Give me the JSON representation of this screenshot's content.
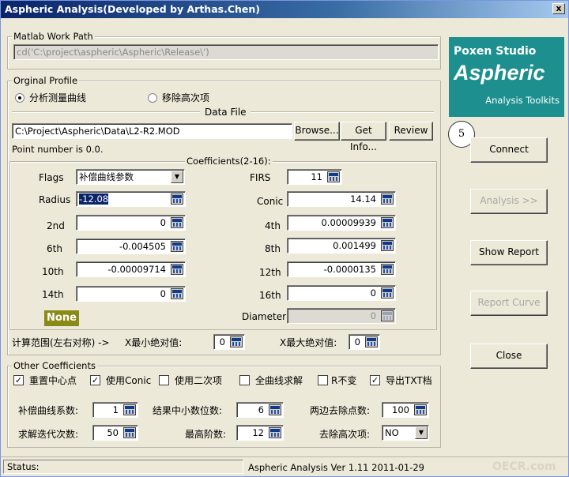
{
  "window": {
    "title": "Aspheric Analysis(Developed by Arthas.Chen)",
    "close_label": "x"
  },
  "matlab": {
    "legend": "Matlab Work Path",
    "path": "cd('C:\\project\\aspheric\\Aspheric\\Release\\')"
  },
  "profile": {
    "legend": "Orginal Profile",
    "radio_measure": "分析测量曲线",
    "radio_remove": "移除高次项",
    "data_file_label": "Data File",
    "data_file_path": "C:\\Project\\Aspheric\\Data\\L2-R2.MOD",
    "browse": "Browse...",
    "get_info": "Get Info...",
    "review": "Review",
    "point_number": "Point number is 0.0."
  },
  "coefficients": {
    "legend": "Coefficients(2-16):",
    "flags_label": "Flags",
    "flags_value": "补偿曲线参数",
    "firs_label": "FIRS",
    "firs_value": "11",
    "radius_label": "Radius",
    "radius_value": "-12.08",
    "conic_label": "Conic",
    "conic_value": "14.14",
    "c2_label": "2nd",
    "c2_value": "0",
    "c4_label": "4th",
    "c4_value": "0.00009939",
    "c6_label": "6th",
    "c6_value": "-0.004505",
    "c8_label": "8th",
    "c8_value": "0.001499",
    "c10_label": "10th",
    "c10_value": "-0.00009714",
    "c12_label": "12th",
    "c12_value": "-0.0000135",
    "c14_label": "14th",
    "c14_value": "0",
    "c16_label": "16th",
    "c16_value": "0",
    "none_badge": "None",
    "diameter_label": "Diameter",
    "diameter_value": "0",
    "range_label": "计算范围(左右对称) ->",
    "xmin_label": "X最小绝对值:",
    "xmin_value": "0",
    "xmax_label": "X最大绝对值:",
    "xmax_value": "0"
  },
  "other": {
    "legend": "Other Coefficients",
    "chk_recenter": "重置中心点",
    "chk_conic": "使用Conic",
    "chk_quadratic": "使用二次项",
    "chk_fullcurve": "全曲线求解",
    "chk_rfixed": "R不变",
    "chk_export": "导出TXT档",
    "comp_coef_label": "补偿曲线系数:",
    "comp_coef_value": "1",
    "decimals_label": "结果中小数位数:",
    "decimals_value": "6",
    "edge_remove_label": "两边去除点数:",
    "edge_remove_value": "100",
    "iterations_label": "求解迭代次数:",
    "iterations_value": "50",
    "max_order_label": "最高阶数:",
    "max_order_value": "12",
    "remove_high_label": "去除高次项:",
    "remove_high_value": "NO"
  },
  "logo": {
    "studio": "Poxen Studio",
    "product": "Aspheric",
    "tagline": "Analysis Toolkits"
  },
  "side_buttons": {
    "connect": "Connect",
    "analysis": "Analysis >>",
    "show_report": "Show Report",
    "report_curve": "Report Curve",
    "close": "Close"
  },
  "marker": "5",
  "status": {
    "label": "Status:",
    "version": "Aspheric Analysis  Ver 1.11 2011-01-29",
    "watermark": "OECR.com"
  }
}
